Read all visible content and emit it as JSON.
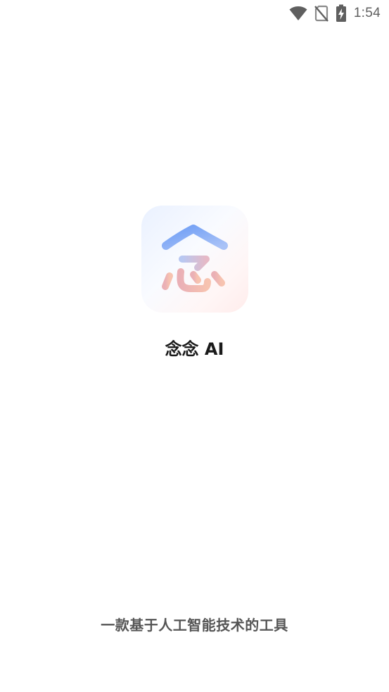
{
  "status_bar": {
    "time": "1:54",
    "icons": [
      "wifi-icon",
      "no-sim-icon",
      "battery-charging-icon"
    ]
  },
  "app": {
    "name": "念念 AI",
    "icon_name": "app-logo-icon",
    "slogan": "一款基于人工智能技术的工具"
  },
  "colors": {
    "background": "#ffffff",
    "logo_blue": "#7aa4f5",
    "logo_pink": "#f4a6a6",
    "title": "#1a1a1a",
    "slogan": "#555555",
    "status": "#5f5f5f"
  }
}
